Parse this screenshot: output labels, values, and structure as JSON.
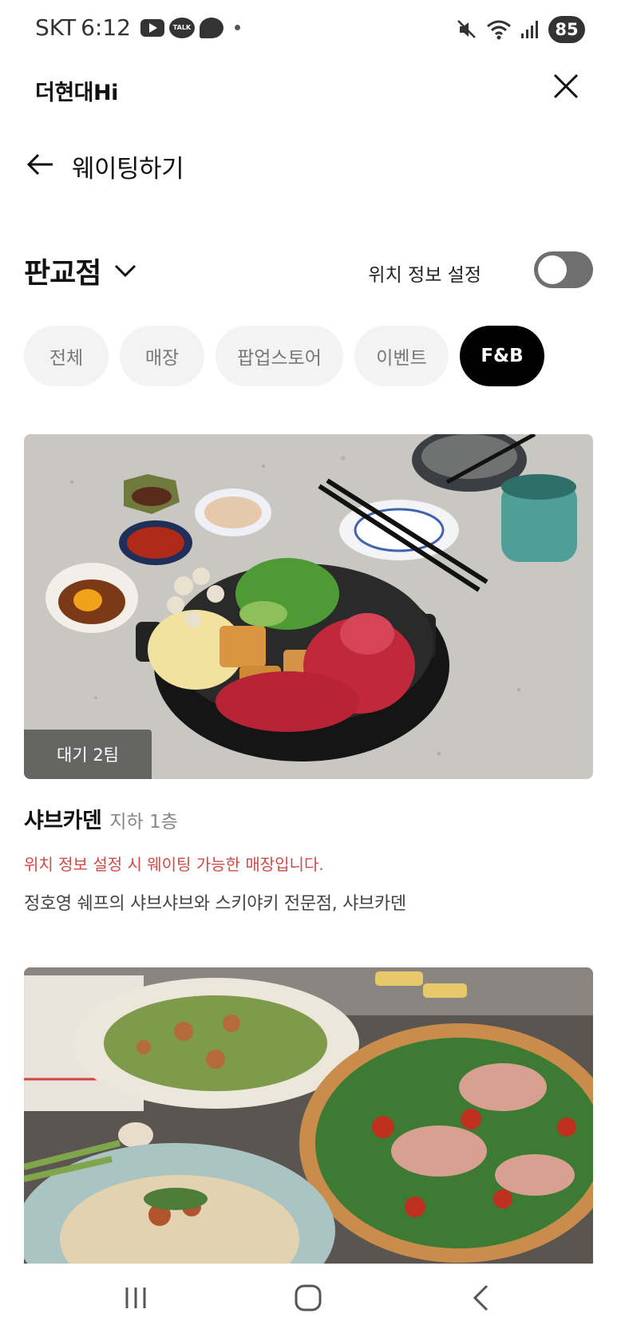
{
  "status_bar": {
    "carrier": "SKT",
    "time": "6:12",
    "talk_icon_text": "TALK",
    "battery": "85",
    "icons": [
      "youtube-icon",
      "kakaotalk-icon",
      "threads-icon",
      "mute-icon",
      "wifi-icon",
      "signal-icon",
      "battery-icon"
    ]
  },
  "app_header": {
    "title": "더현대Hi",
    "close_icon": "close-icon"
  },
  "page_header": {
    "title": "웨이팅하기",
    "back_icon": "back-arrow-icon"
  },
  "store_selector": {
    "store": "판교점",
    "location_label": "위치 정보 설정",
    "location_enabled": false
  },
  "chips": [
    {
      "label": "전체",
      "active": false
    },
    {
      "label": "매장",
      "active": false
    },
    {
      "label": "팝업스토어",
      "active": false
    },
    {
      "label": "이벤트",
      "active": false
    },
    {
      "label": "F&B",
      "active": true
    }
  ],
  "cards": [
    {
      "wait_badge": "대기 2팀",
      "name": "샤브카덴",
      "floor": "지하 1층",
      "notice": "위치 정보 설정 시 웨이팅 가능한 매장입니다.",
      "description": "정호영 쉐프의 샤브샤브와 스키야키 전문점, 샤브카덴"
    },
    {
      "wait_badge": "",
      "name": "",
      "floor": "",
      "notice": "",
      "description": ""
    }
  ],
  "colors": {
    "accent": "#000000",
    "notice": "#d24a43",
    "chip_bg": "#f3f3f3",
    "toggle_off": "#6f6f6f"
  }
}
